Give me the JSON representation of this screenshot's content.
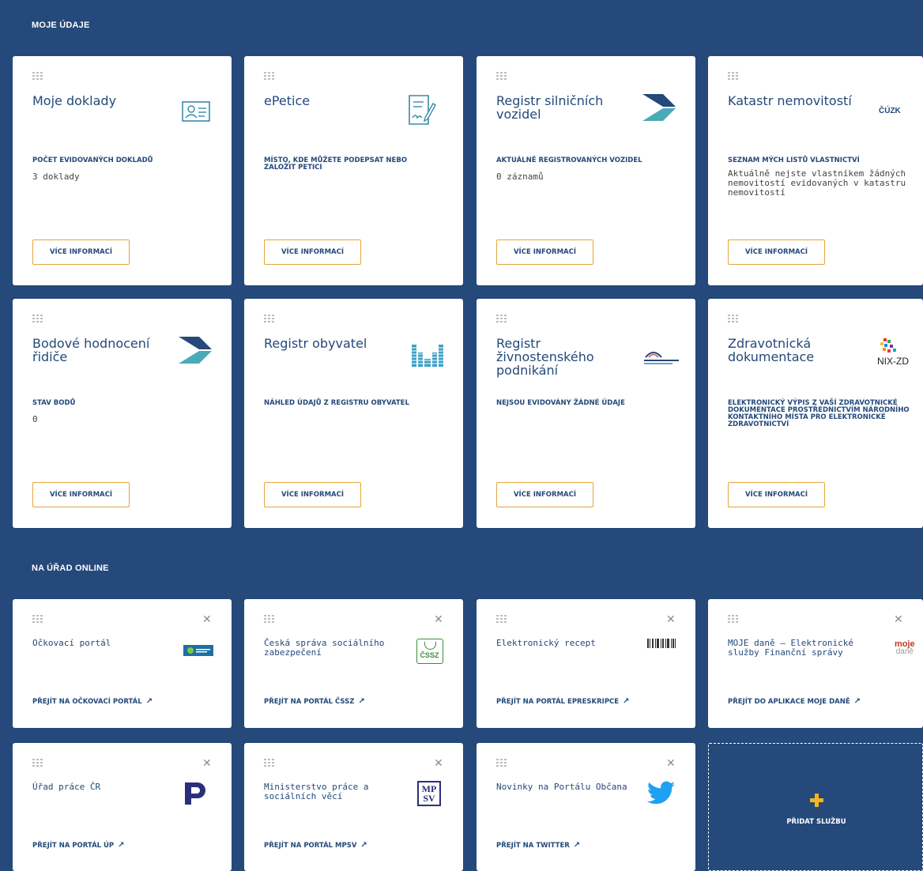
{
  "sections": {
    "my_data_title": "MOJE ÚDAJE",
    "online_title": "NA ÚŘAD ONLINE"
  },
  "data_cards": [
    {
      "title": "Moje doklady",
      "label": "POČET EVIDOVANÝCH DOKLADŮ",
      "value": "3 doklady",
      "button": "VÍCE INFORMACÍ",
      "icon": "id-card-icon"
    },
    {
      "title": "ePetice",
      "label": "MÍSTO, KDE MŮŽETE PODEPSAT NEBO ZALOŽIT PETICI",
      "value": "",
      "button": "VÍCE INFORMACÍ",
      "icon": "petition-document-icon"
    },
    {
      "title": "Registr silničních vozidel",
      "label": "AKTUÁLNĚ REGISTROVANÝCH VOZIDEL",
      "value": "0 záznamů",
      "button": "VÍCE INFORMACÍ",
      "icon": "arrow-chevron-logo"
    },
    {
      "title": "Katastr nemovitostí",
      "label": "SEZNAM MÝCH LISTŮ VLASTNICTVÍ",
      "value": "Aktuálně nejste vlastníkem žádných nemovitostí evidovaných v katastru nemovitostí",
      "button": "VÍCE INFORMACÍ",
      "icon": "cuzk-logo",
      "logo_text": "ČÚZK"
    },
    {
      "title": "Bodové hodnocení řidiče",
      "label": "STAV BODŮ",
      "value": "0",
      "button": "VÍCE INFORMACÍ",
      "icon": "arrow-chevron-logo"
    },
    {
      "title": "Registr obyvatel",
      "label": "NÁHLED ÚDAJŮ Z REGISTRU OBYVATEL",
      "value": "",
      "button": "VÍCE INFORMACÍ",
      "icon": "dotted-m-logo"
    },
    {
      "title": "Registr živnostenského podnikání",
      "label": "NEJSOU EVIDOVÁNY ŽÁDNÉ ÚDAJE",
      "value": "",
      "button": "VÍCE INFORMACÍ",
      "icon": "trade-register-logo"
    },
    {
      "title": "Zdravotnická dokumentace",
      "label": "ELEKTRONICKÝ VÝPIS Z VAŠÍ ZDRAVOTNICKÉ DOKUMENTACE PROSTŘEDNICTVÍM NÁRODNÍHO KONTAKTNÍHO MÍSTA PRO ELEKTRONICKÉ ZDRAVOTNICTVÍ",
      "value": "",
      "button": "VÍCE INFORMACÍ",
      "icon": "nix-zd-logo",
      "logo_text": "NIX-ZD"
    }
  ],
  "online_cards": [
    {
      "title": "Očkovací portál",
      "link": "PŘEJÍT NA OČKOVACÍ PORTÁL",
      "icon": "vaccination-portal-logo"
    },
    {
      "title": "Česká správa sociálního zabezpečení",
      "link": "PŘEJÍT NA PORTÁL ČSSZ",
      "icon": "cssz-logo",
      "logo_text": "ČSSZ"
    },
    {
      "title": "Elektronický recept",
      "link": "PŘEJÍT NA PORTÁL EPRESKRIPCE",
      "icon": "barcode-logo"
    },
    {
      "title": "MOJE daně – Elektronické služby Finanční správy",
      "link": "PŘEJÍT DO APLIKACE MOJE DANĚ",
      "icon": "moje-dane-logo",
      "logo_text_top": "moje",
      "logo_text_bottom": "daně"
    },
    {
      "title": "Úřad práce ČR",
      "link": "PŘEJÍT NA PORTÁL ÚP",
      "icon": "up-logo"
    },
    {
      "title": "Ministerstvo práce a sociálních věcí",
      "link": "PŘEJÍT NA PORTÁL MPSV",
      "icon": "mpsv-logo",
      "logo_text_top": "MP",
      "logo_text_bottom": "SV"
    },
    {
      "title": "Novinky na Portálu Občana",
      "link": "PŘEJÍT NA TWITTER",
      "icon": "twitter-bird-logo"
    }
  ],
  "add_service": {
    "label": "PŘIDAT SLUŽBU"
  },
  "colors": {
    "navy": "#24497a",
    "accent_orange": "#e5a53b",
    "plus_yellow": "#f4b320"
  }
}
